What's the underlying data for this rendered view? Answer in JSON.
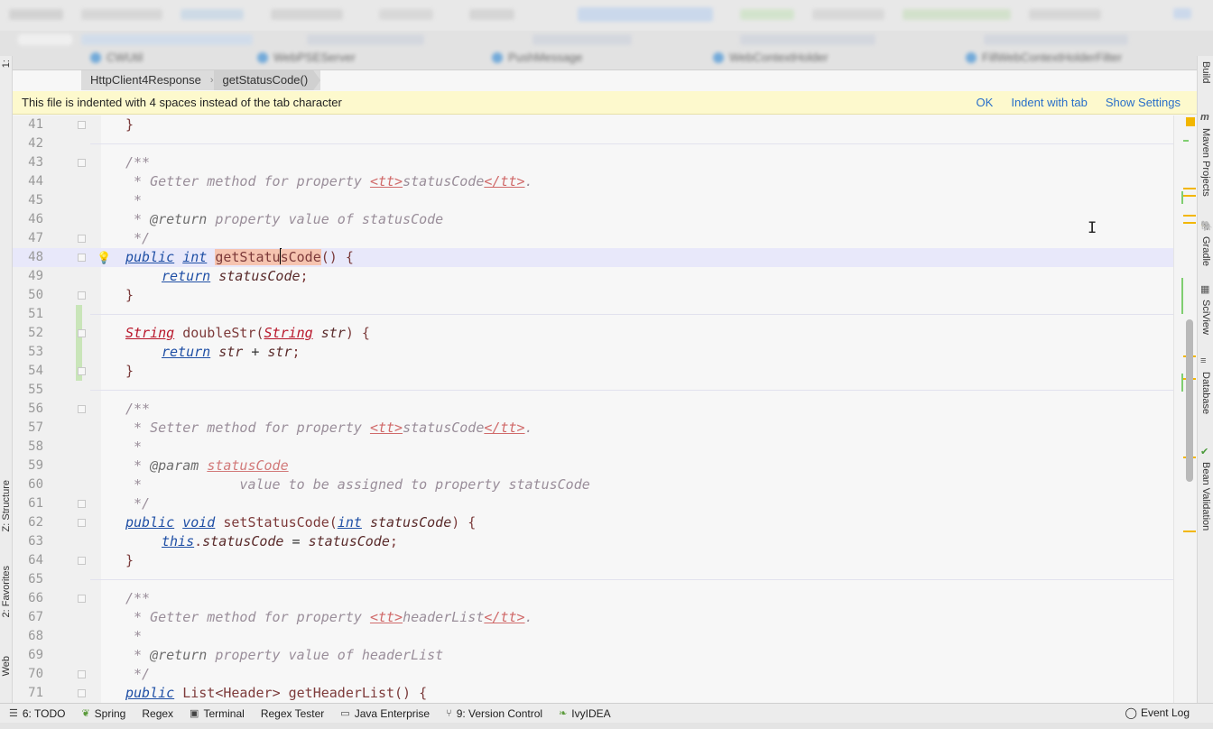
{
  "breadcrumb": {
    "items": [
      "HttpClient4Response",
      "getStatusCode()"
    ]
  },
  "banner": {
    "message": "This file is indented with 4 spaces instead of the tab character",
    "actions": [
      "OK",
      "Indent with tab",
      "Show Settings"
    ]
  },
  "editor": {
    "current_line": 48,
    "lines": [
      {
        "n": "41",
        "segs": [
          [
            "punct",
            "}"
          ]
        ],
        "ind": 1
      },
      {
        "n": "42",
        "segs": []
      },
      {
        "n": "43",
        "segs": [
          [
            "cm",
            "/**"
          ]
        ],
        "ind": 1
      },
      {
        "n": "44",
        "segs": [
          [
            "cm",
            " * Getter method for property "
          ],
          [
            "cm-tt",
            "<tt>"
          ],
          [
            "cm",
            "statusCode"
          ],
          [
            "cm-tt",
            "</tt>"
          ],
          [
            "cm",
            "."
          ]
        ],
        "ind": 1
      },
      {
        "n": "45",
        "segs": [
          [
            "cm",
            " *"
          ]
        ],
        "ind": 1
      },
      {
        "n": "46",
        "segs": [
          [
            "cm",
            " * "
          ],
          [
            "cm-tag",
            "@return"
          ],
          [
            "cm",
            " property value of statusCode"
          ]
        ],
        "ind": 1
      },
      {
        "n": "47",
        "segs": [
          [
            "cm",
            " */"
          ]
        ],
        "ind": 1
      },
      {
        "n": "48",
        "segs": [
          [
            "kw",
            "public"
          ],
          [
            "plain",
            " "
          ],
          [
            "kw",
            "int"
          ],
          [
            "plain",
            " "
          ],
          [
            "fn-hl",
            "getStatu"
          ],
          [
            "caret",
            ""
          ],
          [
            "fn-hl",
            "sCode"
          ],
          [
            "punct",
            "() {"
          ]
        ],
        "ind": 1
      },
      {
        "n": "49",
        "segs": [
          [
            "kw",
            "return"
          ],
          [
            "plain",
            " "
          ],
          [
            "var",
            "statusCode"
          ],
          [
            "punct",
            ";"
          ]
        ],
        "ind": 2
      },
      {
        "n": "50",
        "segs": [
          [
            "punct",
            "}"
          ]
        ],
        "ind": 1
      },
      {
        "n": "51",
        "segs": []
      },
      {
        "n": "52",
        "segs": [
          [
            "type-red",
            "String"
          ],
          [
            "plain",
            " "
          ],
          [
            "fn",
            "doubleStr"
          ],
          [
            "punct",
            "("
          ],
          [
            "type-red",
            "String"
          ],
          [
            "plain",
            " "
          ],
          [
            "var",
            "str"
          ],
          [
            "punct",
            ") {"
          ]
        ],
        "ind": 1
      },
      {
        "n": "53",
        "segs": [
          [
            "kw",
            "return"
          ],
          [
            "plain",
            " "
          ],
          [
            "var",
            "str"
          ],
          [
            "plain",
            " + "
          ],
          [
            "var",
            "str"
          ],
          [
            "punct",
            ";"
          ]
        ],
        "ind": 2
      },
      {
        "n": "54",
        "segs": [
          [
            "punct",
            "}"
          ]
        ],
        "ind": 1
      },
      {
        "n": "55",
        "segs": []
      },
      {
        "n": "56",
        "segs": [
          [
            "cm",
            "/**"
          ]
        ],
        "ind": 1
      },
      {
        "n": "57",
        "segs": [
          [
            "cm",
            " * Setter method for property "
          ],
          [
            "cm-tt",
            "<tt>"
          ],
          [
            "cm",
            "statusCode"
          ],
          [
            "cm-tt",
            "</tt>"
          ],
          [
            "cm",
            "."
          ]
        ],
        "ind": 1
      },
      {
        "n": "58",
        "segs": [
          [
            "cm",
            " *"
          ]
        ],
        "ind": 1
      },
      {
        "n": "59",
        "segs": [
          [
            "cm",
            " * "
          ],
          [
            "cm-tag",
            "@param"
          ],
          [
            "cm",
            " "
          ],
          [
            "cm-ref",
            "statusCode"
          ]
        ],
        "ind": 1
      },
      {
        "n": "60",
        "segs": [
          [
            "cm",
            " *            value to be assigned to property statusCode"
          ]
        ],
        "ind": 1
      },
      {
        "n": "61",
        "segs": [
          [
            "cm",
            " */"
          ]
        ],
        "ind": 1
      },
      {
        "n": "62",
        "segs": [
          [
            "kw",
            "public"
          ],
          [
            "plain",
            " "
          ],
          [
            "kw",
            "void"
          ],
          [
            "plain",
            " "
          ],
          [
            "fn",
            "setStatusCode"
          ],
          [
            "punct",
            "("
          ],
          [
            "kw",
            "int"
          ],
          [
            "plain",
            " "
          ],
          [
            "var",
            "statusCode"
          ],
          [
            "punct",
            ") {"
          ]
        ],
        "ind": 1
      },
      {
        "n": "63",
        "segs": [
          [
            "kw",
            "this"
          ],
          [
            "punct",
            "."
          ],
          [
            "var",
            "statusCode"
          ],
          [
            "plain",
            " = "
          ],
          [
            "var",
            "statusCode"
          ],
          [
            "punct",
            ";"
          ]
        ],
        "ind": 2
      },
      {
        "n": "64",
        "segs": [
          [
            "punct",
            "}"
          ]
        ],
        "ind": 1
      },
      {
        "n": "65",
        "segs": []
      },
      {
        "n": "66",
        "segs": [
          [
            "cm",
            "/**"
          ]
        ],
        "ind": 1
      },
      {
        "n": "67",
        "segs": [
          [
            "cm",
            " * Getter method for property "
          ],
          [
            "cm-tt",
            "<tt>"
          ],
          [
            "cm",
            "headerList"
          ],
          [
            "cm-tt",
            "</tt>"
          ],
          [
            "cm",
            "."
          ]
        ],
        "ind": 1
      },
      {
        "n": "68",
        "segs": [
          [
            "cm",
            " *"
          ]
        ],
        "ind": 1
      },
      {
        "n": "69",
        "segs": [
          [
            "cm",
            " * "
          ],
          [
            "cm-tag",
            "@return"
          ],
          [
            "cm",
            " property value of headerList"
          ]
        ],
        "ind": 1
      },
      {
        "n": "70",
        "segs": [
          [
            "cm",
            " */"
          ]
        ],
        "ind": 1
      },
      {
        "n": "71",
        "segs": [
          [
            "kw",
            "public"
          ],
          [
            "plain",
            " "
          ],
          [
            "fn",
            "List"
          ],
          [
            "punct",
            "<"
          ],
          [
            "fn",
            "Header"
          ],
          [
            "punct",
            "> "
          ],
          [
            "fn",
            "getHeaderList"
          ],
          [
            "punct",
            "() {"
          ]
        ],
        "ind": 1
      }
    ]
  },
  "right_tool_windows": [
    "Build",
    "Maven Projects",
    "Gradle",
    "SciView",
    "Database",
    "Bean Validation"
  ],
  "left_tool_windows": [
    "1:",
    "Z: Structure",
    "2: Favorites",
    "Web"
  ],
  "bottom_tool_windows": [
    {
      "icon": "list-icon",
      "label": "6: TODO"
    },
    {
      "icon": "spring-icon",
      "label": "Spring"
    },
    {
      "icon": "",
      "label": "Regex"
    },
    {
      "icon": "terminal-icon",
      "label": "Terminal"
    },
    {
      "icon": "",
      "label": "Regex Tester"
    },
    {
      "icon": "java-enterprise-icon",
      "label": "Java Enterprise"
    },
    {
      "icon": "vcs-icon",
      "label": "9: Version Control"
    },
    {
      "icon": "ivy-icon",
      "label": "IvyIDEA"
    }
  ],
  "event_log": "Event Log",
  "colors": {
    "banner_bg": "#fdf9cd",
    "link": "#2a6fc9",
    "keyword": "#1f4fa5",
    "current_line_bg": "#e8e8fa",
    "method_highlight": "#f6c4b0"
  }
}
